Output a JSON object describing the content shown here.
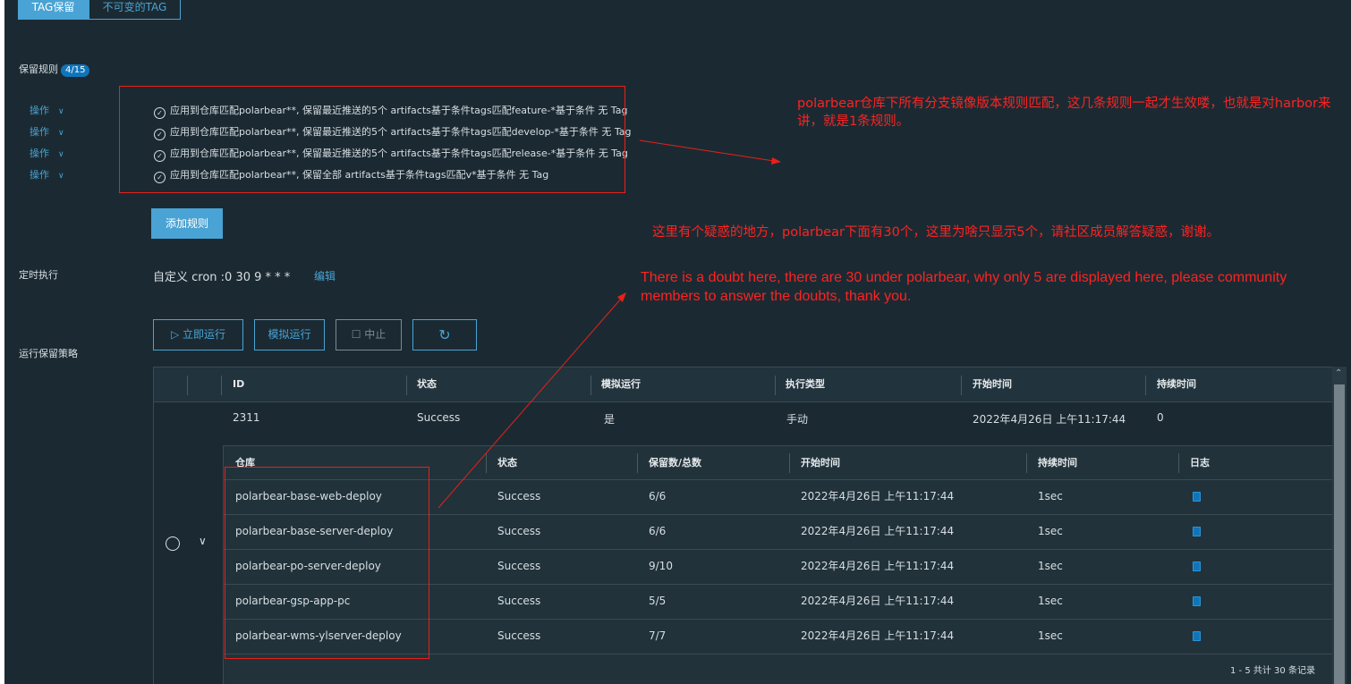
{
  "tabs": {
    "active": "TAG保留",
    "inactive": "不可变的TAG"
  },
  "rules_section": {
    "label": "保留规则",
    "badge": "4/15",
    "rules": [
      {
        "action": "操作",
        "text": "应用到仓库匹配polarbear**, 保留最近推送的5个 artifacts基于条件tags匹配feature-*基于条件 无 Tag"
      },
      {
        "action": "操作",
        "text": "应用到仓库匹配polarbear**, 保留最近推送的5个 artifacts基于条件tags匹配develop-*基于条件 无 Tag"
      },
      {
        "action": "操作",
        "text": "应用到仓库匹配polarbear**, 保留最近推送的5个 artifacts基于条件tags匹配release-*基于条件 无 Tag"
      },
      {
        "action": "操作",
        "text": "应用到仓库匹配polarbear**, 保留全部 artifacts基于条件tags匹配v*基于条件 无 Tag"
      }
    ],
    "add_button": "添加规则"
  },
  "schedule": {
    "label": "定时执行",
    "value": "自定义 cron :0 30 9 * * *",
    "edit": "编辑"
  },
  "run": {
    "label": "运行保留策略",
    "run_now": "立即运行",
    "dry_run": "模拟运行",
    "abort": "中止"
  },
  "executions": {
    "headers": [
      "ID",
      "状态",
      "模拟运行",
      "执行类型",
      "开始时间",
      "持续时间"
    ],
    "row": {
      "id": "2311",
      "status": "Success",
      "dry_run": "是",
      "type": "手动",
      "start": "2022年4月26日 上午11:17:44",
      "duration": "0"
    }
  },
  "tasks": {
    "headers": [
      "仓库",
      "状态",
      "保留数/总数",
      "开始时间",
      "持续时间",
      "日志"
    ],
    "rows": [
      {
        "repo": "polarbear-base-web-deploy",
        "status": "Success",
        "retained": "6/6",
        "start": "2022年4月26日 上午11:17:44",
        "duration": "1sec"
      },
      {
        "repo": "polarbear-base-server-deploy",
        "status": "Success",
        "retained": "6/6",
        "start": "2022年4月26日 上午11:17:44",
        "duration": "1sec"
      },
      {
        "repo": "polarbear-po-server-deploy",
        "status": "Success",
        "retained": "9/10",
        "start": "2022年4月26日 上午11:17:44",
        "duration": "1sec"
      },
      {
        "repo": "polarbear-gsp-app-pc",
        "status": "Success",
        "retained": "5/5",
        "start": "2022年4月26日 上午11:17:44",
        "duration": "1sec"
      },
      {
        "repo": "polarbear-wms-ylserver-deploy",
        "status": "Success",
        "retained": "7/7",
        "start": "2022年4月26日 上午11:17:44",
        "duration": "1sec"
      }
    ],
    "pagination": "1 - 5 共计 30 条记录"
  },
  "annotations": {
    "note1": "polarbear仓库下所有分支镜像版本规则匹配，这几条规则一起才生效喽，也就是对harbor来讲，就是1条规则。",
    "note2": "这里有个疑惑的地方，polarbear下面有30个，这里为啥只显示5个，请社区成员解答疑惑，谢谢。",
    "note3": "There is a doubt here, there are 30 under polarbear, why only 5 are displayed here, please community members to answer the doubts, thank you."
  },
  "colors": {
    "background": "#1b2a32",
    "accent": "#49a3d4",
    "annotation": "#ff2222"
  },
  "icons": [
    "check-circle-icon",
    "chevron-down-icon",
    "play-icon",
    "stop-icon",
    "refresh-icon",
    "radio-icon",
    "log-icon",
    "scroll-up-icon"
  ]
}
